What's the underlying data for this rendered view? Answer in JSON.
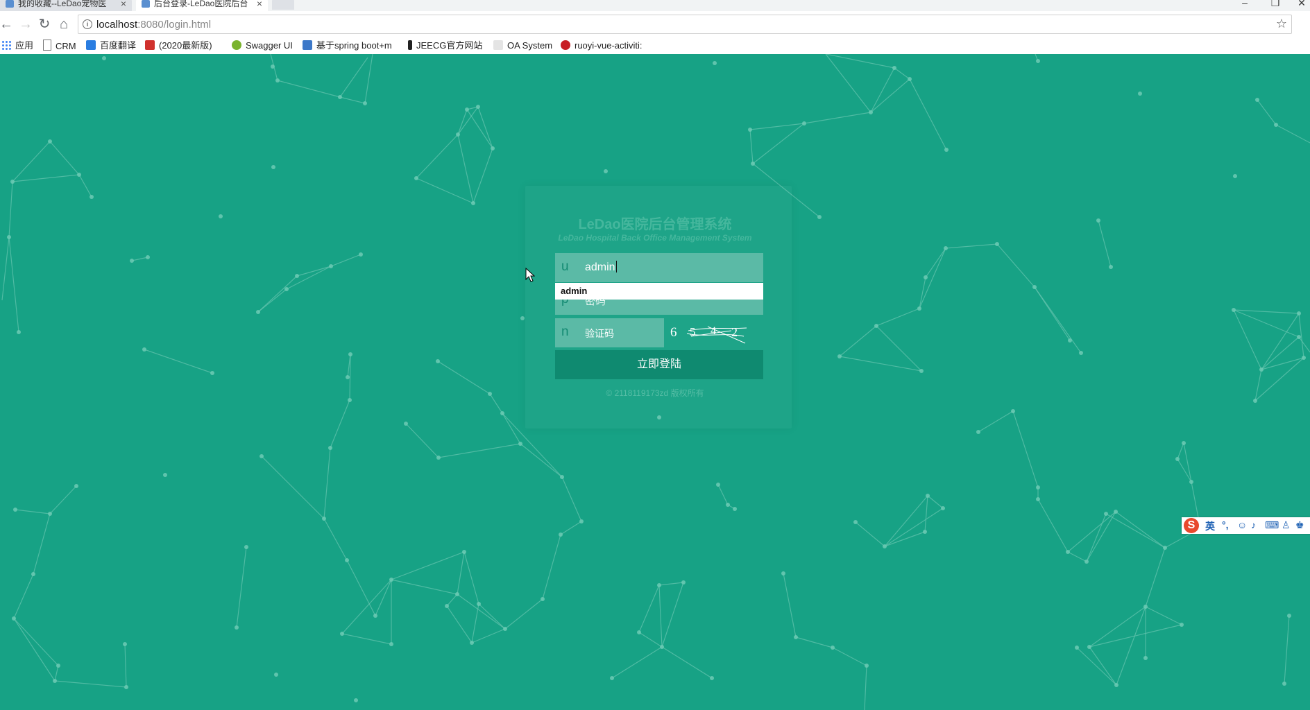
{
  "browser": {
    "tabs": [
      {
        "title": "我的收藏--LeDao宠物医",
        "active": false
      },
      {
        "title": "后台登录-LeDao医院后台",
        "active": true
      }
    ],
    "url_host": "localhost",
    "url_path": ":8080/login.html",
    "bookmarks": [
      {
        "label": "应用",
        "icon": "apps-grid-icon"
      },
      {
        "label": "CRM",
        "icon": "page-icon"
      },
      {
        "label": "百度翻译",
        "icon": "translate-icon"
      },
      {
        "label": "(2020最新版)",
        "icon": "c-logo-icon"
      },
      {
        "label": "Swagger UI",
        "icon": "swagger-icon"
      },
      {
        "label": "基于spring boot+m",
        "icon": "grid-doc-icon"
      },
      {
        "label": "JEECG官方网站",
        "icon": "j-logo-icon"
      },
      {
        "label": "OA System",
        "icon": "oa-icon"
      },
      {
        "label": "ruoyi-vue-activiti: ",
        "icon": "gitee-icon"
      }
    ]
  },
  "login": {
    "title": "LeDao医院后台管理系统",
    "subtitle": "LeDao Hospital Back Office Management System",
    "username": {
      "prefix": "u",
      "value": "admin"
    },
    "autocomplete_option": "admin",
    "password": {
      "prefix": "p",
      "placeholder": "密码"
    },
    "captcha": {
      "prefix": "n",
      "placeholder": "验证码",
      "chars": [
        "6",
        "5",
        "4",
        "2"
      ]
    },
    "submit_label": "立即登陆",
    "copyright": "© 2118119173zd 版权所有"
  },
  "ime": {
    "logo": "S",
    "mode": "英"
  },
  "colors": {
    "background": "#17a285",
    "field": "#5bbaa6",
    "button": "#0f8a70",
    "title": "#45b79d"
  }
}
